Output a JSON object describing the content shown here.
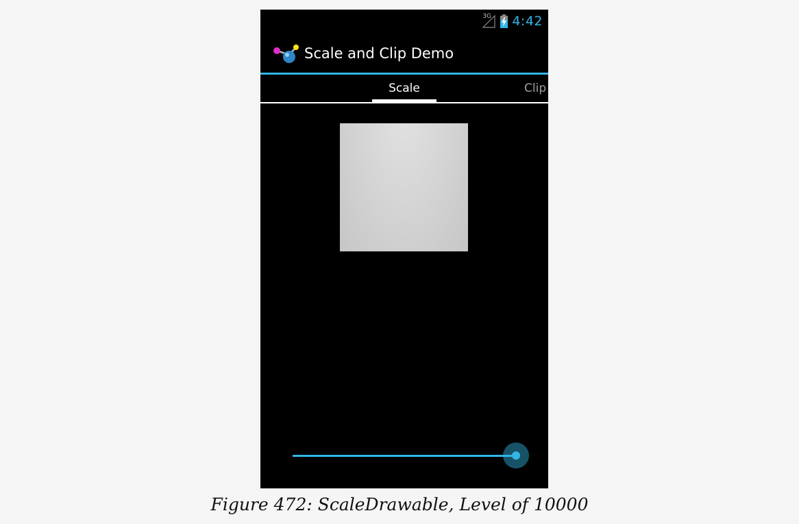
{
  "status_bar": {
    "network_type": "3G",
    "time": "4:42",
    "icons": [
      "signal-3g-icon",
      "battery-charging-icon"
    ],
    "accent_color": "#33b5e5"
  },
  "action_bar": {
    "app_icon": "app-logo-icon",
    "title": "Scale and Clip Demo"
  },
  "tabs": [
    {
      "label": "Scale",
      "selected": true
    },
    {
      "label": "Clip",
      "selected": false
    }
  ],
  "seekbar": {
    "level_fraction": 1.0
  },
  "caption": "Figure 472: ScaleDrawable, Level of 10000"
}
